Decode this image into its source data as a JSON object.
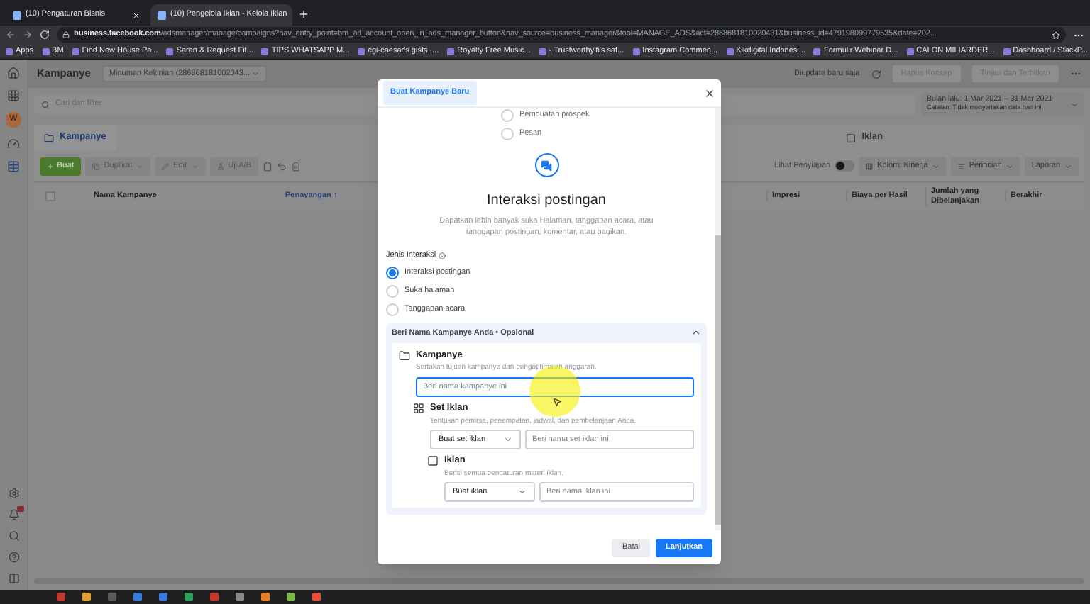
{
  "browser": {
    "tabs": [
      {
        "title": "(10) Pengaturan Bisnis",
        "selected": false
      },
      {
        "title": "(10) Pengelola Iklan - Kelola Iklan",
        "selected": true
      }
    ],
    "url": "**business.facebook.com**/adsmanager/manage/campaigns?nav_entry_point=bm_ad_account_open_in_ads_manager_button&nav_source=business_manager&tool=MANAGE_ADS&act=2868681810020431&business_id=479198099779535&date=202...",
    "bookmarks": [
      "Apps",
      "BM",
      "Find New House Pa...",
      "Saran & Request Fit...",
      "TIPS WHATSAPP M...",
      "cgi-caesar's gists ·...",
      "Royalty Free Music...",
      "- Trustworthy'fi's saf...",
      "Instagram Commen...",
      "Kikdigital Indonesi...",
      "Formulir Webinar D...",
      "CALON MILIARDER...",
      "Dashboard / StackP..."
    ]
  },
  "sidebar": {
    "avatar": "W"
  },
  "header": {
    "title": "Kampanye",
    "account": "Minuman Kekinian (286868181002043...",
    "status": "Diupdate baru saja",
    "buttons": [
      "Hapus Konsep",
      "Tinjau dan Terbitkan"
    ]
  },
  "search": {
    "placeholder": "Cari dan filter"
  },
  "date_range": {
    "label": "Bulan lalu: 1 Mar 2021 – 31 Mar 2021",
    "note": "Catatan: Tidak menyertakan data hari ini"
  },
  "level_tabs": [
    {
      "label": "Kampanye",
      "selected": true
    },
    {
      "label": "Iklan",
      "selected": false
    }
  ],
  "toolbar": {
    "create": "Buat",
    "buttons": [
      "Duplikat",
      "Edit",
      "Uji A/B"
    ],
    "setup_toggle": {
      "label": "Lihat Penyiapan",
      "on": false
    },
    "menus": [
      "Kolom: Kinerja",
      "Perincian",
      "Laporan"
    ]
  },
  "select_all_checked": false,
  "columns_left": [
    "Nama Kampanye",
    "Penayangan ↑"
  ],
  "columns_right": [
    "Impresi",
    "Biaya per Hasil",
    "Jumlah yang Dibelanjakan",
    "Berakhir"
  ],
  "modal": {
    "title": "Buat Kampanye Baru",
    "objectives": [
      {
        "label": "Pembuatan prospek",
        "selected": false
      },
      {
        "label": "Pesan",
        "selected": false
      }
    ],
    "heading": "Interaksi postingan",
    "description": "Dapatkan lebih banyak suka Halaman, tanggapan acara, atau tanggapan postingan, komentar, atau bagikan.",
    "interaction_label": "Jenis Interaksi",
    "interaction_options": [
      {
        "label": "Interaksi postingan",
        "selected": true
      },
      {
        "label": "Suka halaman",
        "selected": false
      },
      {
        "label": "Tanggapan acara",
        "selected": false
      }
    ],
    "naming": {
      "title": "Beri Nama Kampanye Anda • Opsional",
      "expanded": true,
      "levels": [
        {
          "kind": "campaign",
          "name": "Kampanye",
          "hint": "Sertakan tujuan kampanye dan pengoptimalan anggaran.",
          "placeholder": "Beri nama kampanye ini"
        },
        {
          "kind": "adset",
          "name": "Set Iklan",
          "hint": "Tentukan pemirsa, penempatan, jadwal, dan pembelanjaan Anda.",
          "select": "Buat set iklan",
          "placeholder": "Beri nama set iklan ini"
        },
        {
          "kind": "ad",
          "name": "Iklan",
          "hint": "Berisi semua pengaturan materi iklan.",
          "select": "Buat iklan",
          "placeholder": "Beri nama iklan ini"
        }
      ]
    },
    "cancel": "Batal",
    "continue": "Lanjutkan"
  }
}
